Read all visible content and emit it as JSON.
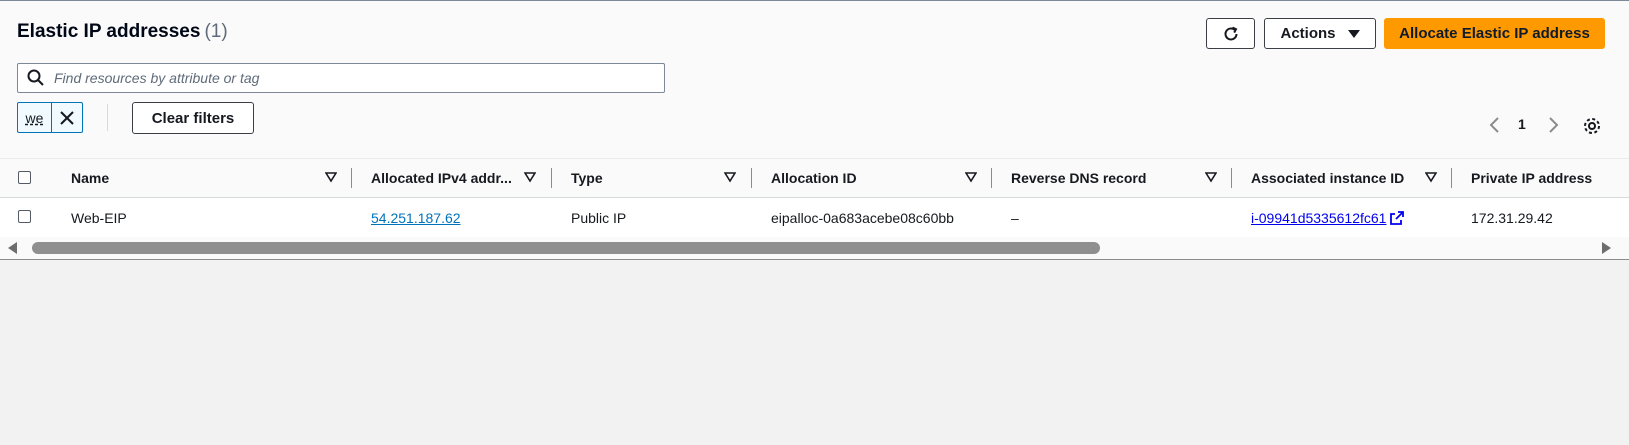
{
  "header": {
    "title": "Elastic IP addresses",
    "count": "(1)",
    "actions_label": "Actions",
    "allocate_label": "Allocate Elastic IP address"
  },
  "search": {
    "placeholder": "Find resources by attribute or tag"
  },
  "filter": {
    "token": "we",
    "clear_label": "Clear filters"
  },
  "pagination": {
    "current_page": "1"
  },
  "table": {
    "columns": [
      "Name",
      "Allocated IPv4 addr...",
      "Type",
      "Allocation ID",
      "Reverse DNS record",
      "Associated instance ID",
      "Private IP address"
    ],
    "rows": [
      {
        "name": "Web-EIP",
        "ipv4": "54.251.187.62",
        "type": "Public IP",
        "allocation_id": "eipalloc-0a683acebe08c60bb",
        "reverse_dns": "–",
        "instance_id": "i-09941d5335612fc61",
        "private_ip": "172.31.29.42"
      }
    ]
  },
  "colors": {
    "primary_button": "#ff9900",
    "link": "#0073bb",
    "token_border": "#0073bb"
  }
}
